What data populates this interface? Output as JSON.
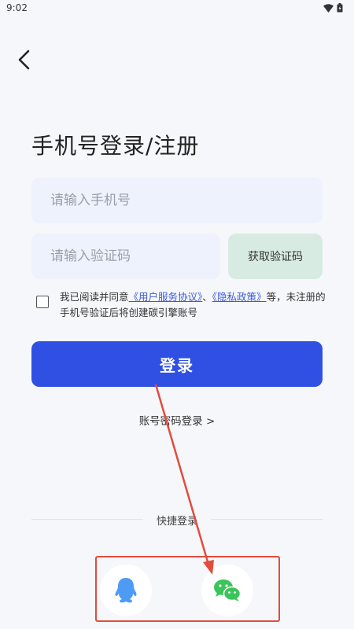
{
  "status": {
    "time": "9:02"
  },
  "title": "手机号登录/注册",
  "phone": {
    "placeholder": "请输入手机号",
    "value": ""
  },
  "code": {
    "placeholder": "请输入验证码",
    "value": "",
    "button_label": "获取验证码"
  },
  "agreement": {
    "prefix": "我已阅读并同意",
    "link_terms": "《用户服务协议》",
    "separator": "、",
    "link_privacy": "《隐私政策》",
    "suffix": "等，未注册的手机号验证后将创建碳引擎账号",
    "checked": false
  },
  "login_button": "登录",
  "password_login": "账号密码登录 >",
  "quick_login": {
    "label": "快捷登录"
  },
  "colors": {
    "primary": "#2f50e2",
    "input_bg": "#eef2fd",
    "code_button_bg": "#d8ebe3",
    "link": "#3b5bd9",
    "annotation": "#e14c3c",
    "qq": "#4e9bf5",
    "wechat": "#3bc45a"
  },
  "icons": [
    "back-arrow-icon",
    "wifi-icon",
    "battery-icon",
    "qq-icon",
    "wechat-icon"
  ]
}
